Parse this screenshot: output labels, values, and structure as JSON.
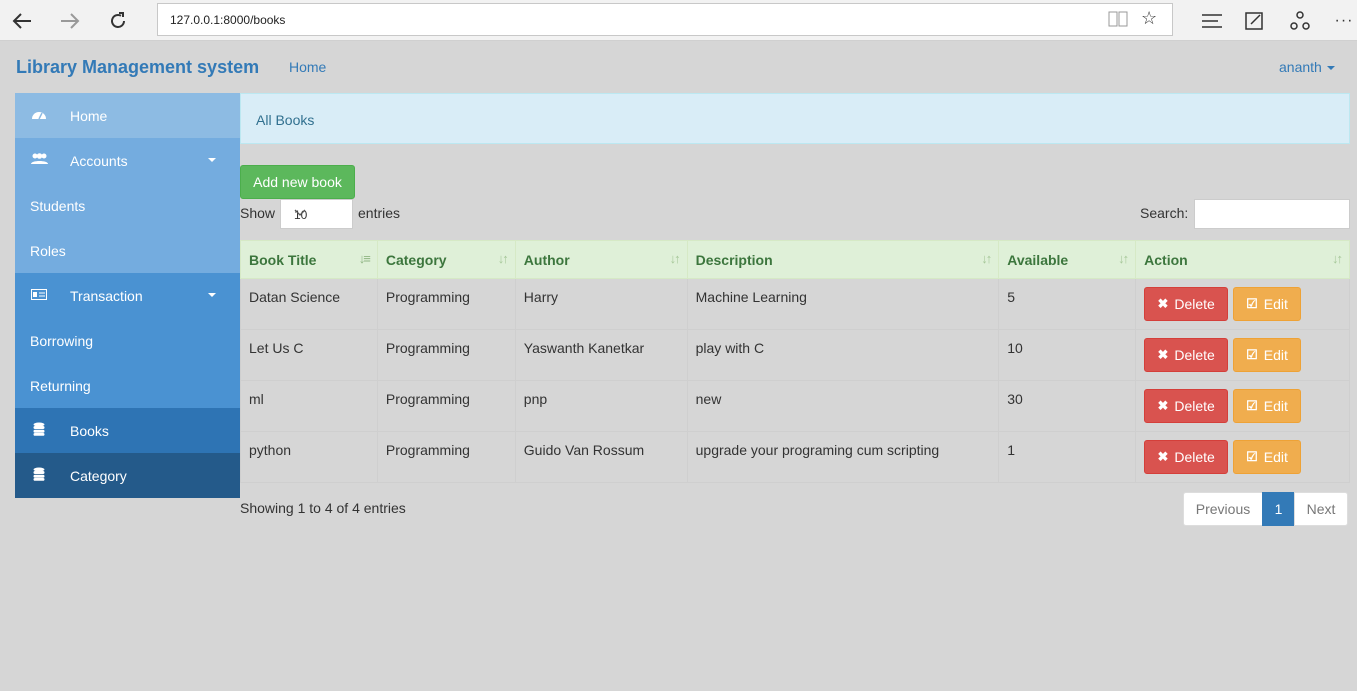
{
  "browser": {
    "url": "127.0.0.1:8000/books",
    "icons": [
      "back-arrow-icon",
      "forward-arrow-icon",
      "refresh-icon",
      "reading-view-icon",
      "favorite-star-icon",
      "hub-icon",
      "web-note-icon",
      "share-icon",
      "more-icon"
    ]
  },
  "navbar": {
    "brand": "Library Management system",
    "home": "Home",
    "user": "ananth"
  },
  "sidebar": {
    "items": [
      {
        "label": "Home",
        "icon": "dashboard-icon",
        "bg": "#8dbbe3"
      },
      {
        "label": "Accounts",
        "icon": "users-icon",
        "bg": "#74acdf"
      },
      {
        "label": "Students",
        "bg": "#74acdf"
      },
      {
        "label": "Roles",
        "bg": "#74acdf"
      },
      {
        "label": "Transaction",
        "icon": "id-card-icon",
        "bg": "#4a92d2"
      },
      {
        "label": "Borrowing",
        "bg": "#4a92d2"
      },
      {
        "label": "Returning",
        "bg": "#4a92d2"
      },
      {
        "label": "Books",
        "icon": "database-icon",
        "bg": "#2e74b4"
      },
      {
        "label": "Category",
        "icon": "database-icon",
        "bg": "#245a8a"
      }
    ]
  },
  "breadcrumb": "All Books",
  "add_button": "Add new book",
  "length_menu": {
    "show": "Show",
    "value": "10",
    "entries": "entries"
  },
  "search": {
    "label": "Search:",
    "value": ""
  },
  "table": {
    "columns": [
      "Book Title",
      "Category",
      "Author",
      "Description",
      "Available",
      "Action"
    ],
    "rows": [
      {
        "title": "Datan Science",
        "category": "Programming",
        "author": "Harry",
        "description": "Machine Learning",
        "available": "5"
      },
      {
        "title": "Let Us C",
        "category": "Programming",
        "author": "Yaswanth Kanetkar",
        "description": "play with C",
        "available": "10"
      },
      {
        "title": "ml",
        "category": "Programming",
        "author": "pnp",
        "description": "new",
        "available": "30"
      },
      {
        "title": "python",
        "category": "Programming",
        "author": "Guido Van Rossum",
        "description": "upgrade your programing cum scripting",
        "available": "1"
      }
    ],
    "delete_label": "Delete",
    "edit_label": "Edit"
  },
  "info": "Showing 1 to 4 of 4 entries",
  "pagination": {
    "previous": "Previous",
    "current": "1",
    "next": "Next"
  },
  "colors": {
    "primary": "#337ab7",
    "success": "#5cb85c",
    "danger": "#d9534f",
    "warning": "#f0ad4e"
  }
}
